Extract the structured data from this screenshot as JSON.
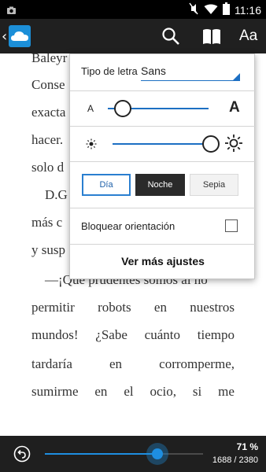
{
  "status_bar": {
    "time": "11:16",
    "icons": [
      "notification-photo-icon",
      "mute-icon",
      "wifi-icon",
      "battery-icon"
    ]
  },
  "action_bar": {
    "icons": [
      "back-chevron-icon",
      "cloud-app-icon",
      "search-icon",
      "book-icon",
      "font-size-icon"
    ],
    "font_icon_label": "Aa"
  },
  "book_text": {
    "lines": [
      {
        "words": [
          "Baleyr"
        ],
        "justify": false
      },
      {
        "words": [
          "Conse"
        ],
        "justify": false
      },
      {
        "words": [
          "exacta"
        ],
        "justify": false
      },
      {
        "words": [
          "hacer."
        ],
        "justify": false
      },
      {
        "words": [
          "solo d"
        ],
        "justify": false
      },
      {
        "words": [
          "    D.G"
        ],
        "justify": false
      },
      {
        "words": [
          "más c"
        ],
        "justify": false
      },
      {
        "words": [
          "y susp"
        ],
        "justify": false
      },
      {
        "words": [
          "    —¡Qué prudentes somos al no"
        ],
        "justify": false
      },
      {
        "words": [
          "permitir",
          "robots",
          "en",
          "nuestros"
        ],
        "justify": true
      },
      {
        "words": [
          "mundos!",
          "¿Sabe",
          "cuánto",
          "tiempo"
        ],
        "justify": true
      },
      {
        "words": [
          "tardaría",
          "en",
          "corromperme,"
        ],
        "justify": true
      },
      {
        "words": [
          "sumirme",
          "en",
          "el",
          "ocio,",
          "si",
          "me"
        ],
        "justify": true
      }
    ]
  },
  "settings_popup": {
    "font_label": "Tipo de letra",
    "font_value": "Sans",
    "size_small_label": "A",
    "size_large_label": "A",
    "size_level": 0.15,
    "brightness_level": 0.98,
    "themes": [
      {
        "label": "Día",
        "selected": true
      },
      {
        "label": "Noche",
        "selected": false
      },
      {
        "label": "Sepia",
        "selected": false
      }
    ],
    "lock_orientation_label": "Bloquear orientación",
    "lock_orientation_checked": false,
    "more_settings_label": "Ver más ajustes"
  },
  "bottom_bar": {
    "percent": "71 %",
    "pages": "1688 / 2380",
    "progress": 0.71
  },
  "colors": {
    "accent": "#1e8ee0",
    "action_bar": "#202020",
    "bottom_bar": "#1f1f1f",
    "night_button": "#2a2a2a"
  }
}
